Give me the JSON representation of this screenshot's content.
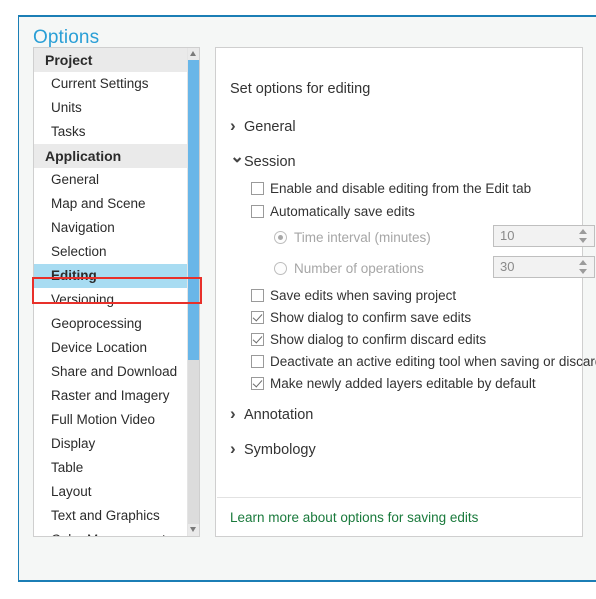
{
  "dialog": {
    "title": "Options",
    "accent_color": "#2a9fd6",
    "border_color": "#1b7eb5"
  },
  "sidebar": {
    "groups": [
      {
        "header": "Project",
        "items": [
          {
            "label": "Current Settings",
            "selected": false
          },
          {
            "label": "Units",
            "selected": false
          },
          {
            "label": "Tasks",
            "selected": false
          }
        ]
      },
      {
        "header": "Application",
        "items": [
          {
            "label": "General",
            "selected": false
          },
          {
            "label": "Map and Scene",
            "selected": false
          },
          {
            "label": "Navigation",
            "selected": false
          },
          {
            "label": "Selection",
            "selected": false
          },
          {
            "label": "Editing",
            "selected": true
          },
          {
            "label": "Versioning",
            "selected": false
          },
          {
            "label": "Geoprocessing",
            "selected": false
          },
          {
            "label": "Device Location",
            "selected": false
          },
          {
            "label": "Share and Download",
            "selected": false
          },
          {
            "label": "Raster and Imagery",
            "selected": false
          },
          {
            "label": "Full Motion Video",
            "selected": false
          },
          {
            "label": "Display",
            "selected": false
          },
          {
            "label": "Table",
            "selected": false
          },
          {
            "label": "Layout",
            "selected": false
          },
          {
            "label": "Text and Graphics",
            "selected": false
          },
          {
            "label": "Color Management",
            "selected": false
          }
        ]
      }
    ],
    "scrollbar": {
      "up_arrow_icon": "scroll-up-arrow-icon",
      "down_arrow_icon": "scroll-down-arrow-icon",
      "thumb_color": "#69b6e8"
    },
    "highlight": {
      "target_label": "Editing",
      "color": "#e8302a"
    }
  },
  "content": {
    "heading": "Set options for editing",
    "sections": [
      {
        "label": "General",
        "expanded": false,
        "chevron_icon": "chevron-right-icon"
      },
      {
        "label": "Session",
        "expanded": true,
        "chevron_icon": "chevron-down-icon"
      },
      {
        "label": "Annotation",
        "expanded": false,
        "chevron_icon": "chevron-right-icon"
      },
      {
        "label": "Symbology",
        "expanded": false,
        "chevron_icon": "chevron-right-icon"
      }
    ],
    "session_options": {
      "enable_disable_editing": {
        "label": "Enable and disable editing from the Edit tab",
        "checked": false
      },
      "auto_save_edits": {
        "label": "Automatically save edits",
        "checked": false
      },
      "time_interval": {
        "label": "Time interval (minutes)",
        "selected": true,
        "disabled": true,
        "value": "10"
      },
      "number_of_operations": {
        "label": "Number of operations",
        "selected": false,
        "disabled": true,
        "value": "30"
      },
      "save_on_project_save": {
        "label": "Save edits when saving project",
        "checked": false
      },
      "confirm_save": {
        "label": "Show dialog to confirm save edits",
        "checked": true
      },
      "confirm_discard": {
        "label": "Show dialog to confirm discard edits",
        "checked": true
      },
      "deactivate_tool": {
        "label": "Deactivate an active editing tool when saving or discarding",
        "checked": false
      },
      "layers_editable": {
        "label": "Make newly added layers editable by default",
        "checked": true
      }
    },
    "footer_link": {
      "label": "Learn more about options for saving edits",
      "color": "#1a7a3c"
    }
  }
}
